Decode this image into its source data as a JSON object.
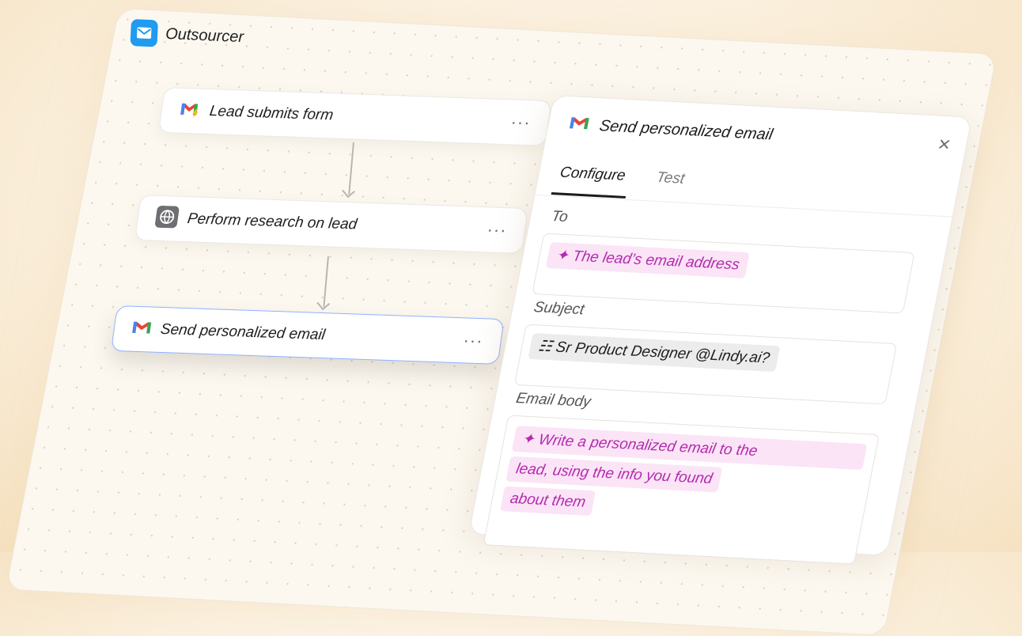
{
  "app": {
    "title": "Outsourcer",
    "icon": "mail-icon",
    "brand_color": "#1f9bf0"
  },
  "workflow": {
    "nodes": [
      {
        "label": "Lead submits form",
        "icon": "gmail-bolt-icon",
        "menu": "···"
      },
      {
        "label": "Perform research on lead",
        "icon": "globe-icon",
        "menu": "···"
      },
      {
        "label": "Send personalized email",
        "icon": "gmail-icon",
        "menu": "···",
        "active": true
      }
    ]
  },
  "panel": {
    "title": "Send personalized email",
    "icon": "gmail-icon",
    "close": "×",
    "tabs": [
      {
        "label": "Configure",
        "selected": true
      },
      {
        "label": "Test"
      }
    ],
    "fields": {
      "to": {
        "label": "To",
        "value": "The lead’s email address"
      },
      "subject": {
        "label": "Subject",
        "value": "Sr Product Designer @Lindy.ai?"
      },
      "body": {
        "label": "Email body",
        "lines": [
          "Write a personalized email to the",
          "lead, using the info you found",
          "about them"
        ]
      }
    },
    "colors": {
      "ai_chip_bg": "#fbe4f6",
      "ai_chip_text": "#b42ab0",
      "focus_border": "#8fb2ff"
    }
  }
}
